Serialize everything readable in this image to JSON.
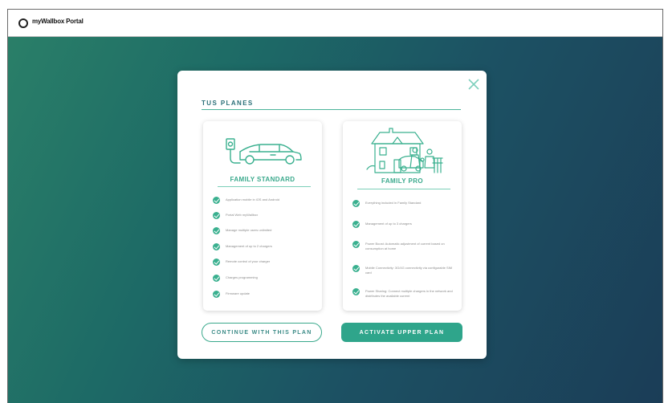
{
  "window": {
    "title": "myWallbox Portal"
  },
  "modal": {
    "heading": "TUS PLANES",
    "plans": [
      {
        "name": "FAMILY STANDARD",
        "illustration": "car-charging-icon",
        "features": [
          "Application mobile in iOS and Android",
          "Portal Web myWallbox",
          "Manage multiple users unlimited",
          "Management of up to 2 chargers",
          "Remote control of your charger",
          "Charges programming",
          "Firmware update"
        ]
      },
      {
        "name": "FAMILY PRO",
        "illustration": "family-house-icon",
        "features": [
          "Everything included in Family Standard",
          "Management of up to 3 chargers",
          "Power Boost: Automatic adjustment of current based on consumption at home",
          "Mobile Connectivity: 3G/4G connectivity via configurable SIM card",
          "Power Sharing: Connect multiple chargers in the network and distributes the available current"
        ]
      }
    ],
    "buttons": {
      "continue": "CONTINUE WITH THIS PLAN",
      "activate": "ACTIVATE UPPER PLAN"
    }
  },
  "colors": {
    "accent": "#3aa98c",
    "heading": "#2a6f78",
    "bg_start": "#2a7f68",
    "bg_end": "#1b3d57"
  }
}
